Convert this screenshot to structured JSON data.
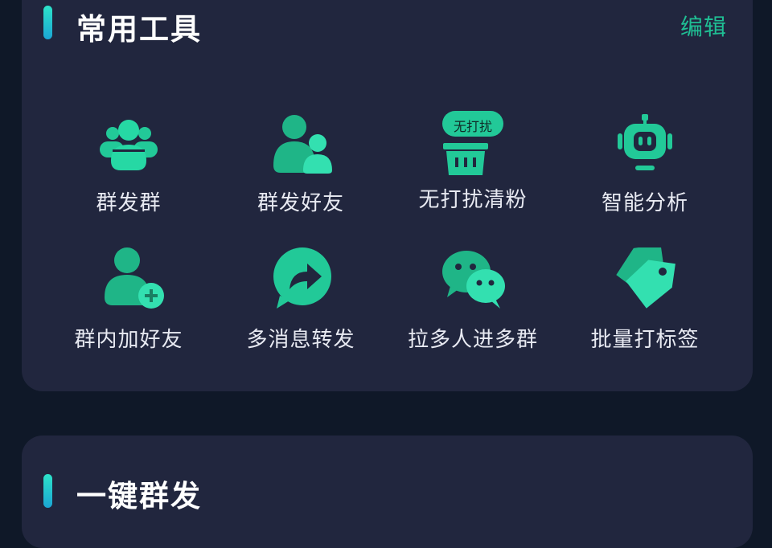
{
  "sections": {
    "tools": {
      "title": "常用工具",
      "edit_label": "编辑"
    },
    "broadcast": {
      "title": "一键群发"
    }
  },
  "tools": [
    {
      "label": "群发群",
      "icon": "group-broadcast-icon"
    },
    {
      "label": "群发好友",
      "icon": "friends-broadcast-icon"
    },
    {
      "label": "无打扰清粉",
      "icon": "quiet-clean-icon",
      "badge": "无打扰"
    },
    {
      "label": "智能分析",
      "icon": "robot-icon"
    },
    {
      "label": "群内加好友",
      "icon": "add-friend-icon"
    },
    {
      "label": "多消息转发",
      "icon": "forward-message-icon"
    },
    {
      "label": "拉多人进多群",
      "icon": "wechat-chat-icon"
    },
    {
      "label": "批量打标签",
      "icon": "tag-icon"
    }
  ],
  "colors": {
    "background": "#0f1828",
    "card": "#21263e",
    "accent_green": "#1fbf94",
    "icon_green": "#22c998",
    "text": "#e8eaf2"
  }
}
